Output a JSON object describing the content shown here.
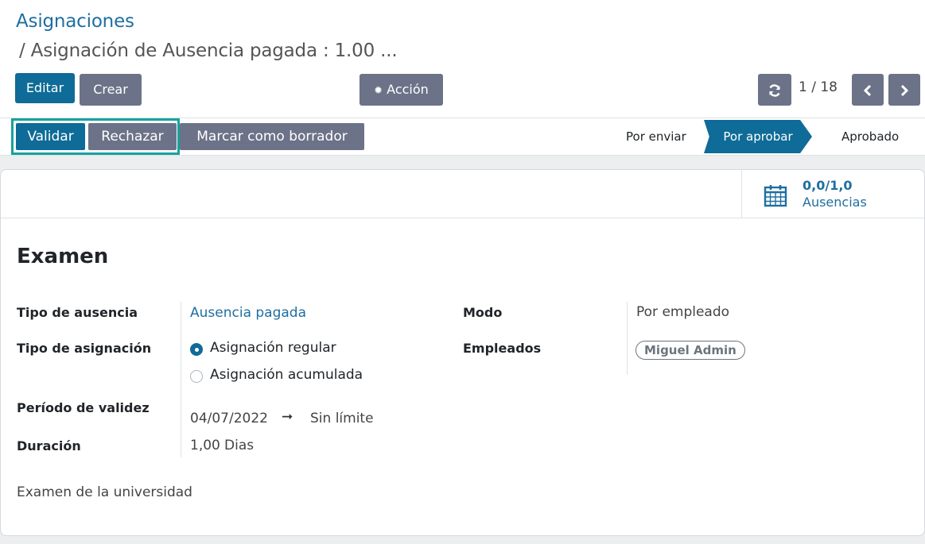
{
  "breadcrumb": {
    "parent": "Asignaciones",
    "current": "/ Asignación de Ausencia pagada : 1.00 ..."
  },
  "buttons": {
    "edit": "Editar",
    "create": "Crear",
    "action": "Acción"
  },
  "pager": {
    "value": "1 / 18"
  },
  "status_buttons": {
    "validate": "Validar",
    "refuse": "Rechazar",
    "draft": "Marcar como borrador"
  },
  "stages": [
    {
      "label": "Por enviar",
      "active": false
    },
    {
      "label": "Por aprobar",
      "active": true
    },
    {
      "label": "Aprobado",
      "active": false
    }
  ],
  "smart_button": {
    "value": "0,0/1,0",
    "label": "Ausencias"
  },
  "form": {
    "title": "Examen",
    "leave_type_label": "Tipo de ausencia",
    "leave_type_value": "Ausencia pagada",
    "allocation_type_label": "Tipo de asignación",
    "allocation_options": [
      "Asignación regular",
      "Asignación acumulada"
    ],
    "allocation_selected": "Asignación regular",
    "validity_label": "Período de validez",
    "date_from": "04/07/2022",
    "date_to": "Sin límite",
    "duration_label": "Duración",
    "duration_value": "1,00",
    "duration_unit": "Dias",
    "mode_label": "Modo",
    "mode_value": "Por empleado",
    "employees_label": "Empleados",
    "employees": [
      "Miguel Admin"
    ],
    "notes": "Examen de la universidad"
  },
  "colors": {
    "primary": "#0f6b97",
    "secondary": "#6c7388",
    "highlight": "#16a2a0"
  }
}
